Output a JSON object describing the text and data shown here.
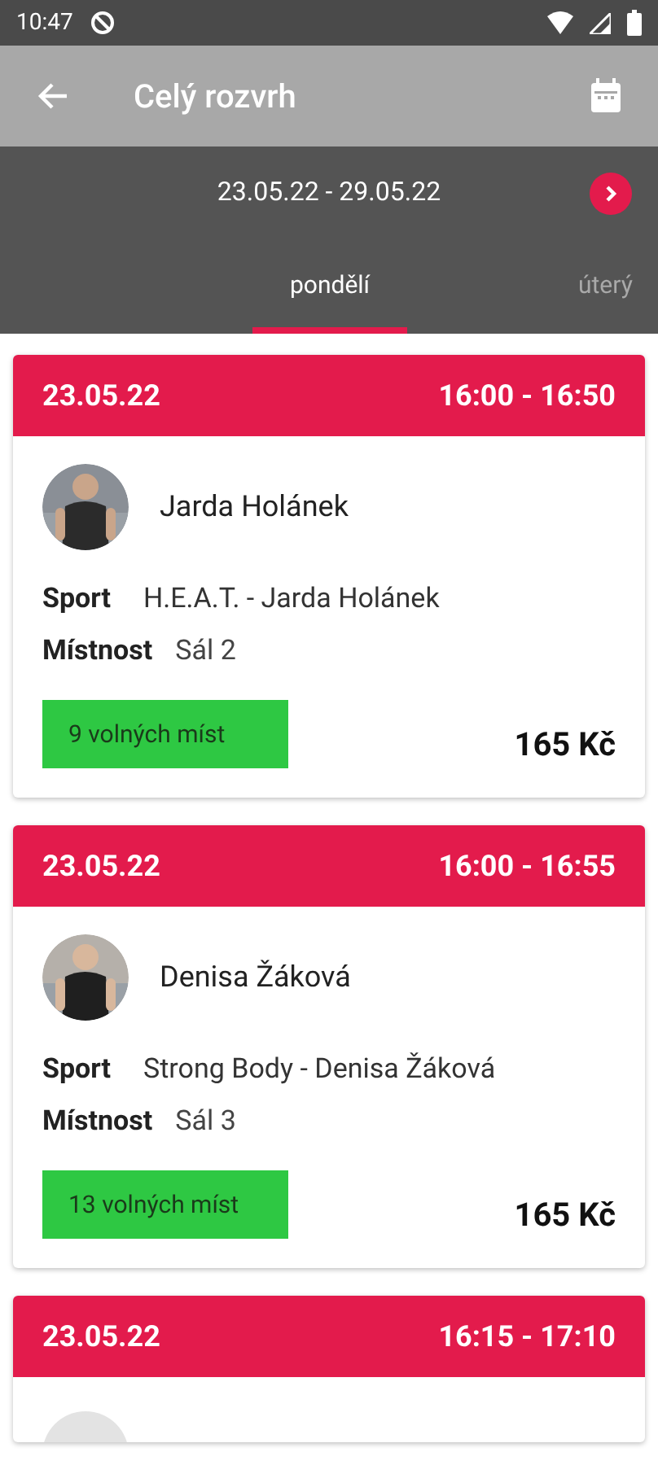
{
  "status_bar": {
    "time": "10:47"
  },
  "app_bar": {
    "title": "Celý rozvrh"
  },
  "week": {
    "range": "23.05.22 - 29.05.22"
  },
  "tabs": [
    {
      "label": "pondělí",
      "selected": true
    },
    {
      "label": "úterý",
      "selected": false
    }
  ],
  "sessions": [
    {
      "date": "23.05.22",
      "time": "16:00 - 16:50",
      "trainer": "Jarda Holánek",
      "sport_label": "Sport",
      "sport": "H.E.A.T. - Jarda Holánek",
      "room_label": "Místnost",
      "room": "Sál 2",
      "spots": "9 volných míst",
      "price": "165 Kč"
    },
    {
      "date": "23.05.22",
      "time": "16:00 - 16:55",
      "trainer": "Denisa Žáková",
      "sport_label": "Sport",
      "sport": "Strong Body - Denisa Žáková",
      "room_label": "Místnost",
      "room": "Sál 3",
      "spots": "13 volných míst",
      "price": "165 Kč"
    },
    {
      "date": "23.05.22",
      "time": "16:15 - 17:10"
    }
  ]
}
